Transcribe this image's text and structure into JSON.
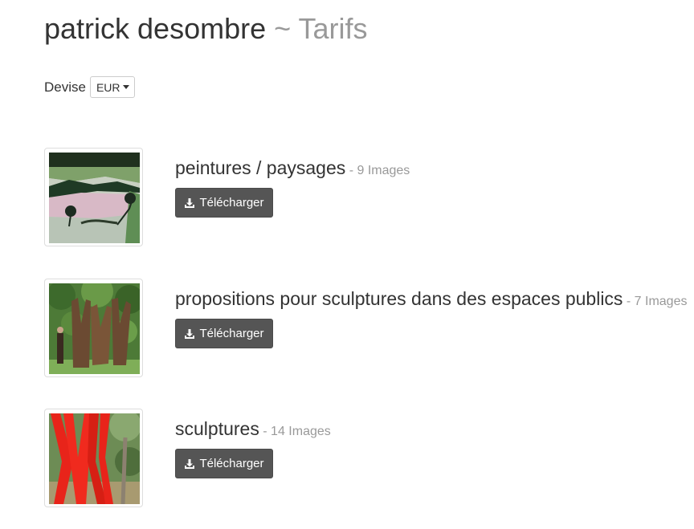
{
  "header": {
    "title_main": "patrick desombre",
    "title_separator": "~",
    "title_sub": "Tarifs"
  },
  "currency": {
    "label": "Devise",
    "selected": "EUR"
  },
  "albums": [
    {
      "title": "peintures / paysages",
      "count": "- 9 Images",
      "button_label": "Télécharger",
      "button_icon": "download-icon",
      "thumbnail": "landscape-painting"
    },
    {
      "title": "propositions pour sculptures dans des espaces publics",
      "count": "- 7 Images",
      "button_label": "Télécharger",
      "button_icon": "download-icon",
      "thumbnail": "steel-tree-sculpture"
    },
    {
      "title": "sculptures",
      "count": "- 14 Images",
      "button_label": "Télécharger",
      "button_icon": "download-icon",
      "thumbnail": "red-sculpture"
    }
  ]
}
